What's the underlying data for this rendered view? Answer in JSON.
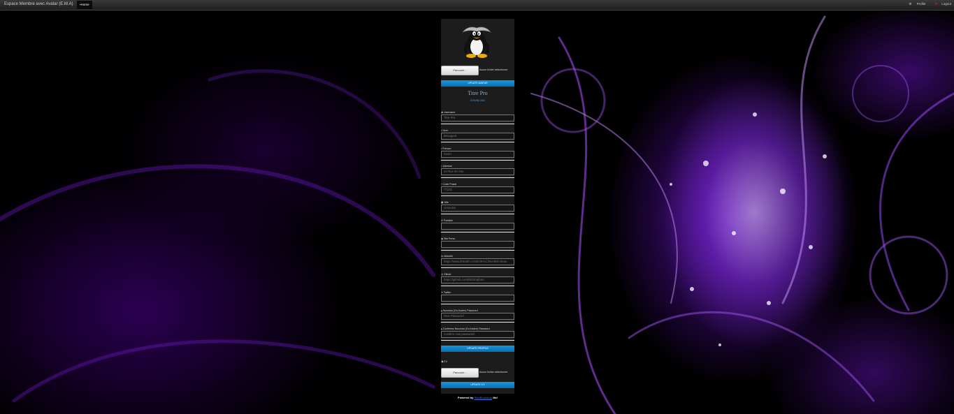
{
  "topbar": {
    "brand": "Espace Membre avec Avatar (E.M.A)",
    "home": "Home",
    "profile": "Profile",
    "logout": "Logout"
  },
  "avatar_form": {
    "browse_label": "Parcourir...",
    "no_file": "Aucun fichier sélectionné.",
    "update_label": "UPDATE AVATAR"
  },
  "user": {
    "name": "Titre Pro",
    "download_label": "DOWNLOAD"
  },
  "fields": [
    {
      "label": "Username",
      "value": "Titre Pro",
      "placeholder": ""
    },
    {
      "label": "Nom",
      "value": "Beaugeol",
      "placeholder": ""
    },
    {
      "label": "Prenom",
      "value": "Kevin",
      "placeholder": ""
    },
    {
      "label": "Adresse",
      "value": "24 Rue de Vue",
      "placeholder": ""
    },
    {
      "label": "Code Postal",
      "value": "77101",
      "placeholder": ""
    },
    {
      "label": "Ville",
      "value": "Limoussi",
      "placeholder": ""
    },
    {
      "label": "Portable",
      "value": "",
      "placeholder": ""
    },
    {
      "label": "Site Perso",
      "value": "",
      "placeholder": ""
    },
    {
      "label": "Linkedin",
      "value": "https://www.linkedin.com/in/K%C3%A9vin-beau",
      "placeholder": ""
    },
    {
      "label": "Github",
      "value": "https://github.com/BEGraphon",
      "placeholder": ""
    },
    {
      "label": "Twitter",
      "value": "",
      "placeholder": ""
    },
    {
      "label": "Nouveau (Ou Ancien) Password",
      "value": "",
      "placeholder": "New Password"
    },
    {
      "label": "Confirmez Nouveau (Ou Ancien) Password",
      "value": "",
      "placeholder": "Confirm new password"
    }
  ],
  "profile_form": {
    "update_label": "UPDATE PROFILE"
  },
  "cv_form": {
    "section_label": "CV",
    "browse_label": "Parcourir...",
    "no_file": "Aucun fichier sélectionné.",
    "update_label": "UPDATE CV"
  },
  "footer": {
    "prefix": "Powered by",
    "link": "StartBootstrap",
    "suffix": "Me!"
  }
}
